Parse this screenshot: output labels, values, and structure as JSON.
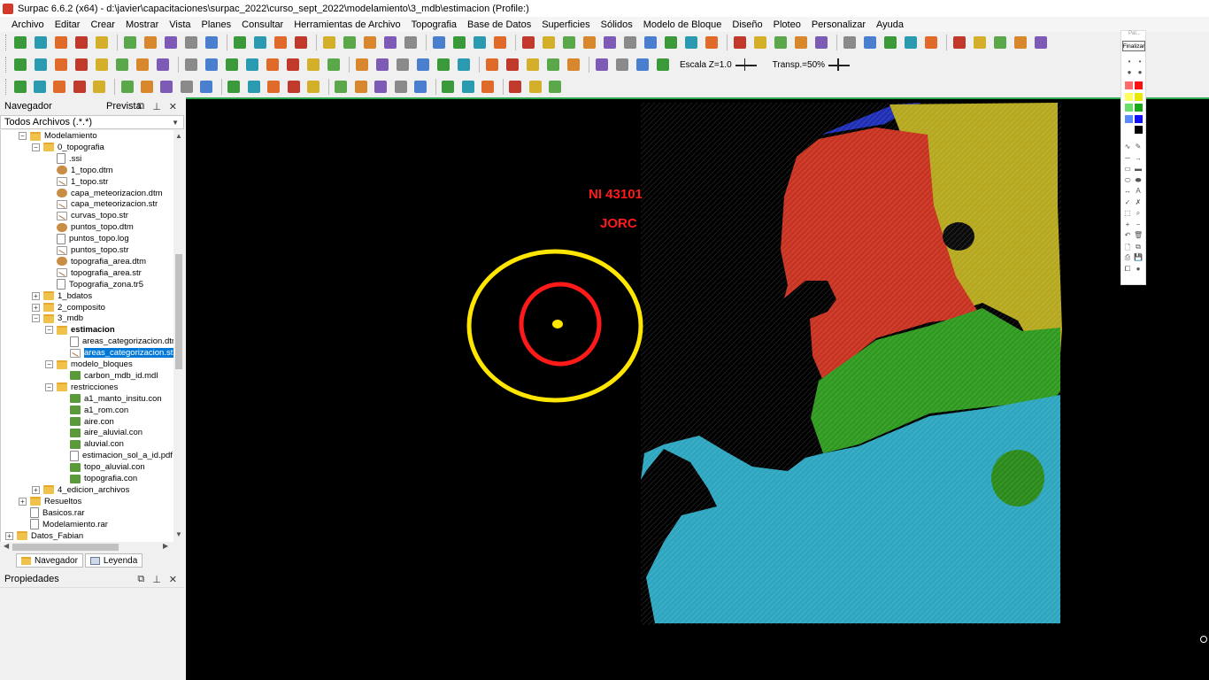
{
  "window": {
    "title": "Surpac 6.6.2 (x64) - d:\\javier\\capacitaciones\\surpac_2022\\curso_sept_2022\\modelamiento\\3_mdb\\estimacion (Profile:)"
  },
  "menu": [
    "Archivo",
    "Editar",
    "Crear",
    "Mostrar",
    "Vista",
    "Planes",
    "Consultar",
    "Herramientas de Archivo",
    "Topografia",
    "Base de Datos",
    "Superficies",
    "Sólidos",
    "Modelo de Bloque",
    "Diseño",
    "Ploteo",
    "Personalizar",
    "Ayuda"
  ],
  "toolbar2": {
    "scale_label": "Escala Z=1.0",
    "transp_label": "Transp.=50%"
  },
  "navigator": {
    "title": "Navegador",
    "preview_label": "Prevista",
    "filter": "Todos Archivos (.*.*)",
    "tree": [
      {
        "label": "Modelamiento",
        "icon": "folder",
        "exp": "-",
        "level": 2
      },
      {
        "label": "0_topografia",
        "icon": "folder",
        "exp": "-",
        "level": 3
      },
      {
        "label": ".ssi",
        "icon": "file",
        "level": 4
      },
      {
        "label": "1_topo.dtm",
        "icon": "dtm",
        "level": 4
      },
      {
        "label": "1_topo.str",
        "icon": "str",
        "level": 4
      },
      {
        "label": "capa_meteorizacion.dtm",
        "icon": "dtm",
        "level": 4
      },
      {
        "label": "capa_meteorizacion.str",
        "icon": "str",
        "level": 4
      },
      {
        "label": "curvas_topo.str",
        "icon": "str",
        "level": 4
      },
      {
        "label": "puntos_topo.dtm",
        "icon": "dtm",
        "level": 4
      },
      {
        "label": "puntos_topo.log",
        "icon": "file",
        "level": 4
      },
      {
        "label": "puntos_topo.str",
        "icon": "str",
        "level": 4
      },
      {
        "label": "topografia_area.dtm",
        "icon": "dtm",
        "level": 4
      },
      {
        "label": "topografia_area.str",
        "icon": "str",
        "level": 4
      },
      {
        "label": "Topografia_zona.tr5",
        "icon": "file",
        "level": 4
      },
      {
        "label": "1_bdatos",
        "icon": "folder",
        "exp": "+",
        "level": 3
      },
      {
        "label": "2_composito",
        "icon": "folder",
        "exp": "+",
        "level": 3
      },
      {
        "label": "3_mdb",
        "icon": "folder",
        "exp": "-",
        "level": 3
      },
      {
        "label": "estimacion",
        "icon": "folder",
        "exp": "-",
        "level": 4,
        "bold": true
      },
      {
        "label": "areas_categorizacion.dtm",
        "icon": "file",
        "level": 5
      },
      {
        "label": "areas_categorizacion.str",
        "icon": "str",
        "level": 5,
        "selected": true
      },
      {
        "label": "modelo_bloques",
        "icon": "folder",
        "exp": "-",
        "level": 4
      },
      {
        "label": "carbon_mdb_id.mdl",
        "icon": "conf",
        "level": 5
      },
      {
        "label": "restricciones",
        "icon": "folder",
        "exp": "-",
        "level": 4
      },
      {
        "label": "a1_manto_insitu.con",
        "icon": "conf",
        "level": 5
      },
      {
        "label": "a1_rom.con",
        "icon": "conf",
        "level": 5
      },
      {
        "label": "aire.con",
        "icon": "conf",
        "level": 5
      },
      {
        "label": "aire_aluvial.con",
        "icon": "conf",
        "level": 5
      },
      {
        "label": "aluvial.con",
        "icon": "conf",
        "level": 5
      },
      {
        "label": "estimacion_sol_a_id.pdf",
        "icon": "file",
        "level": 5
      },
      {
        "label": "topo_aluvial.con",
        "icon": "conf",
        "level": 5
      },
      {
        "label": "topografia.con",
        "icon": "conf",
        "level": 5
      },
      {
        "label": "4_edicion_archivos",
        "icon": "folder",
        "exp": "+",
        "level": 3
      },
      {
        "label": "Resueltos",
        "icon": "folder",
        "exp": "+",
        "level": 2
      },
      {
        "label": "Basicos.rar",
        "icon": "file",
        "level": 2
      },
      {
        "label": "Modelamiento.rar",
        "icon": "file",
        "level": 2
      },
      {
        "label": "Datos_Fabian",
        "icon": "folder",
        "exp": "+",
        "level": 1
      }
    ]
  },
  "tabs": {
    "navegador": "Navegador",
    "leyenda": "Leyenda"
  },
  "properties": {
    "title": "Propiedades"
  },
  "viewport": {
    "label1": "NI 43101",
    "label2": "JORC"
  },
  "palette": {
    "header": "Pal...",
    "finish_label": "Finalizar"
  },
  "colors": {
    "selection": "#0078d7",
    "viewport_bg": "#000000",
    "label_red": "#ff1a1a",
    "ring_yellow": "#ffe600",
    "ring_red": "#ff1a1a"
  }
}
